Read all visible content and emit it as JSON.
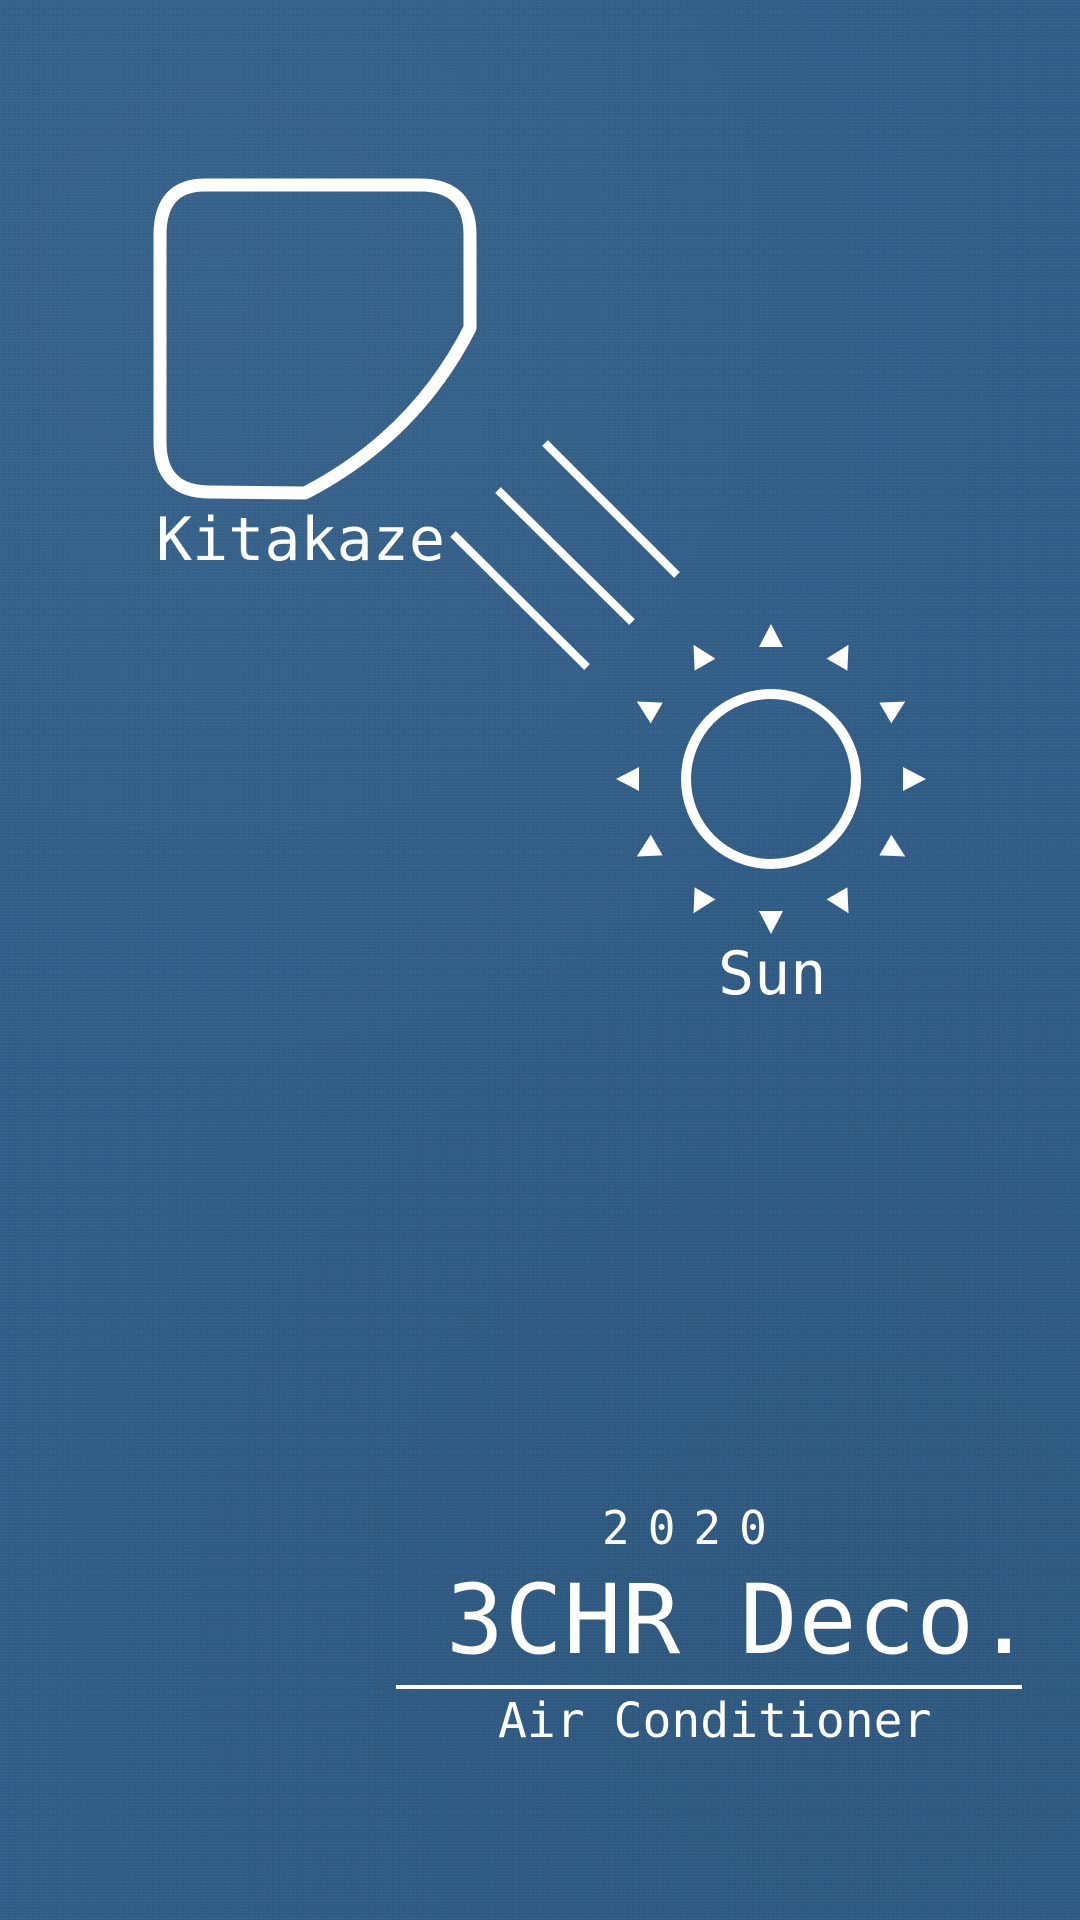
{
  "labels": {
    "device": "Kitakaze",
    "sun": "Sun",
    "year": "2020",
    "brand": "3CHR Deco.",
    "product": "Air Conditioner"
  },
  "colors": {
    "background": "#2f5c86",
    "foreground": "#ffffff"
  },
  "icons": {
    "device": "air-conditioner-vent-icon",
    "airflow": "airflow-lines-icon",
    "sun": "sun-icon"
  }
}
